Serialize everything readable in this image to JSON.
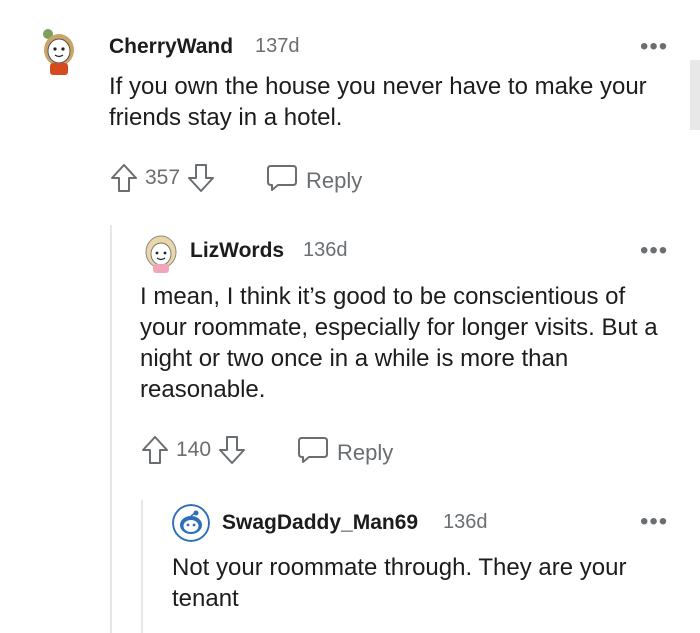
{
  "comments": [
    {
      "username": "CherryWand",
      "age": "137d",
      "text": "If you own the house you never have to make your friends stay in a hotel.",
      "votes": "357",
      "reply_label": "Reply",
      "avatar_colors": {
        "bg": "#fff3e0",
        "hair": "#c9a56a",
        "shirt": "#d64a1f"
      }
    },
    {
      "username": "LizWords",
      "age": "136d",
      "text": "I mean, I think it’s good to be conscientious of your roommate, especially for longer visits. But a night or two once in a while is more than reasonable.",
      "votes": "140",
      "reply_label": "Reply",
      "avatar_colors": {
        "bg": "#fdeef0",
        "hair": "#e9d7a8",
        "shirt": "#f0a6b8"
      }
    },
    {
      "username": "SwagDaddy_Man69",
      "age": "136d",
      "text": "Not your roommate through. They are your tenant",
      "avatar_colors": {
        "bg": "#ffffff",
        "head": "#2c6fb8",
        "face": "#ffffff"
      }
    }
  ],
  "more_label": "•••",
  "colors": {
    "meta": "#6a6e71",
    "text": "#1c1c1c",
    "thread": "#e6e6e6"
  }
}
